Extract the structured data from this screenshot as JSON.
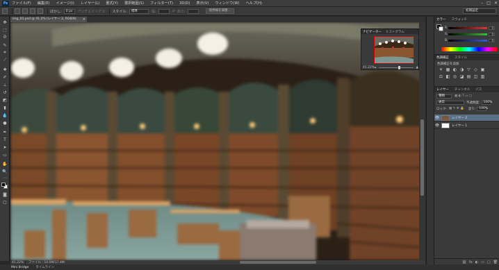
{
  "app": {
    "logo": "Ps"
  },
  "menu": [
    "ファイル(F)",
    "編集(E)",
    "イメージ(I)",
    "レイヤー(L)",
    "書式(Y)",
    "選択範囲(S)",
    "フィルター(T)",
    "3D(D)",
    "表示(V)",
    "ウィンドウ(W)",
    "ヘルプ(H)"
  ],
  "window_controls": [
    "–",
    "□",
    "✕"
  ],
  "options": {
    "feather_label": "ぼかし:",
    "feather_value": "0 px",
    "antialias_label": "アンチエイリアス",
    "style_label": "スタイル:",
    "style_value": "標準",
    "width_label": "幅:",
    "height_label": "高さ:",
    "refine_button": "境界線を調整...",
    "workspace": "初期設定"
  },
  "document": {
    "tab_title": "img_01.psd @ 41.2% (レイヤー 2, RGB/8)",
    "close": "×"
  },
  "status": {
    "zoom": "41.22%",
    "doc_info": "ファイル : 10.0M/17.4M"
  },
  "bottom_tabs": [
    "Mini Bridge",
    "タイムライン"
  ],
  "navigator": {
    "tabs": [
      "ナビゲーター",
      "ヒストグラム"
    ],
    "zoom": "41.22%"
  },
  "color_panel": {
    "tabs": [
      "カラー",
      "スウォッチ"
    ],
    "r_label": "R",
    "g_label": "G",
    "b_label": "B",
    "r_value": "0",
    "g_value": "0",
    "b_value": "0",
    "colors": {
      "r": "#d93a3a",
      "g": "#3ac23a",
      "b": "#3a5bd9"
    }
  },
  "adjustments": {
    "tabs": [
      "色調補正",
      "スタイル"
    ],
    "title": "色調補正を追加",
    "icons": [
      "☀",
      "▦",
      "◐",
      "◑",
      "▽",
      "◇",
      "▣",
      "⚖",
      "◧",
      "◎",
      "◪",
      "▤",
      "◫",
      "▥"
    ]
  },
  "layers": {
    "tabs": [
      "レイヤー",
      "チャンネル",
      "パス"
    ],
    "filter_label": "種類",
    "blend_mode": "通常",
    "opacity_label": "不透明度:",
    "opacity_value": "100%",
    "lock_label": "ロック:",
    "fill_label": "塗り:",
    "fill_value": "100%",
    "items": [
      {
        "name": "レイヤー 2",
        "selected": true
      },
      {
        "name": "レイヤー 1",
        "selected": false
      }
    ],
    "foot_icons": [
      "⛓",
      "fx",
      "◐",
      "▭",
      "▢",
      "🗑"
    ]
  }
}
